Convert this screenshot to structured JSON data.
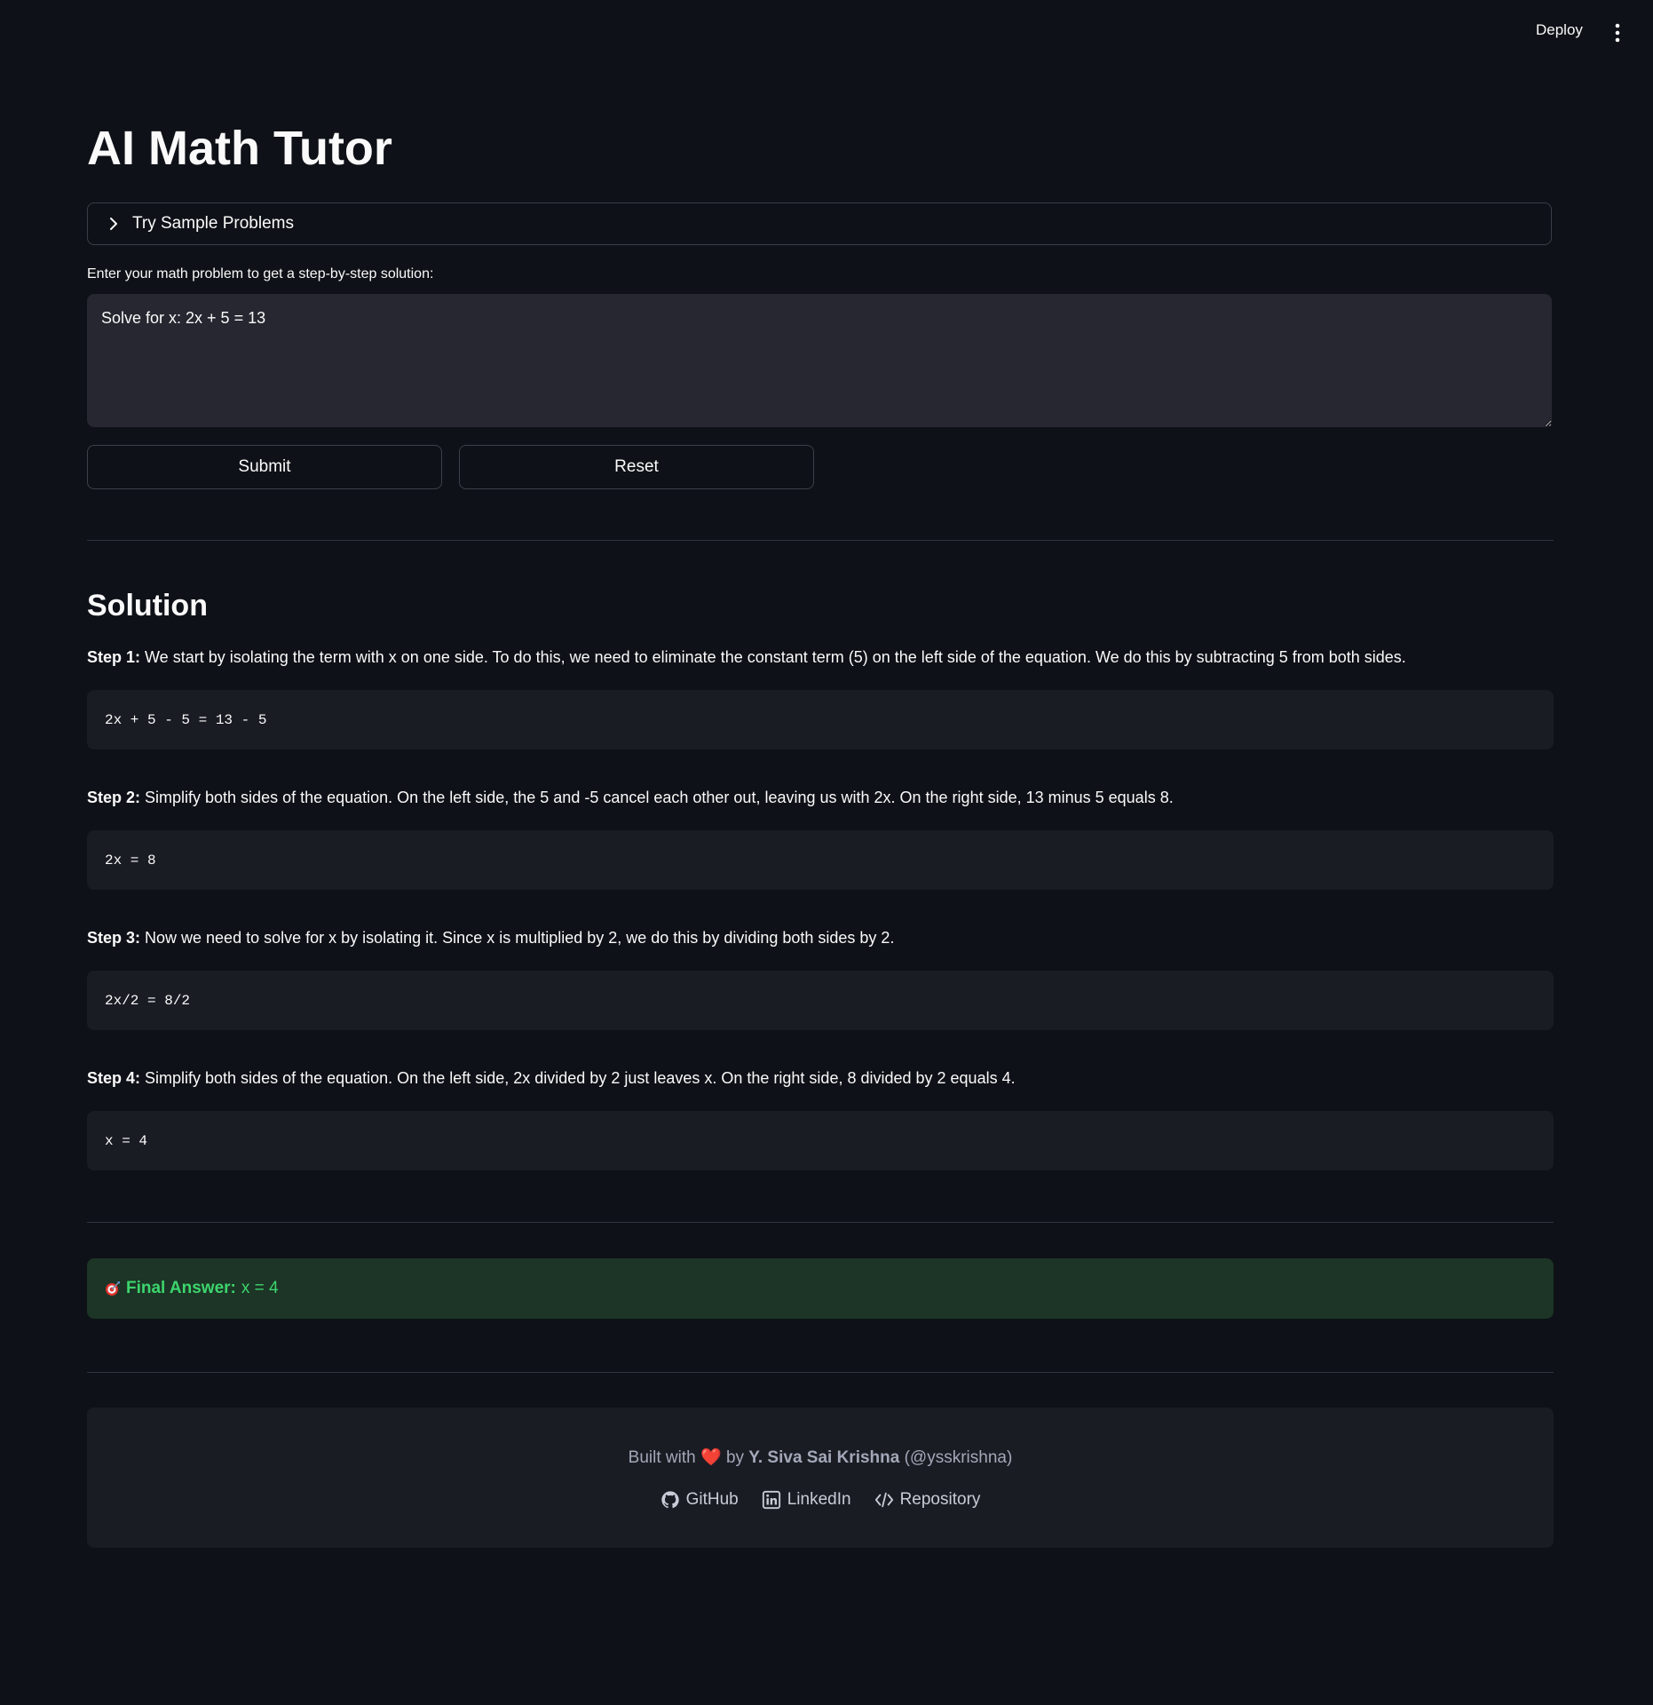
{
  "topbar": {
    "deploy_label": "Deploy",
    "menu_icon": "more-vertical-icon"
  },
  "app": {
    "title": "AI Math Tutor"
  },
  "samples": {
    "label": "Try Sample Problems",
    "icon": "chevron-right-icon"
  },
  "input": {
    "label": "Enter your math problem to get a step-by-step solution:",
    "value": "Solve for x: 2x + 5 = 13"
  },
  "buttons": {
    "submit": "Submit",
    "reset": "Reset"
  },
  "solution": {
    "heading": "Solution",
    "steps": [
      {
        "label": "Step 1:",
        "text": " We start by isolating the term with x on one side. To do this, we need to eliminate the constant term (5) on the left side of the equation. We do this by subtracting 5 from both sides.",
        "code": "2x + 5 - 5 = 13 - 5"
      },
      {
        "label": "Step 2:",
        "text": " Simplify both sides of the equation. On the left side, the 5 and -5 cancel each other out, leaving us with 2x. On the right side, 13 minus 5 equals 8.",
        "code": "2x = 8"
      },
      {
        "label": "Step 3:",
        "text": " Now we need to solve for x by isolating it. Since x is multiplied by 2, we do this by dividing both sides by 2.",
        "code": "2x/2 = 8/2"
      },
      {
        "label": "Step 4:",
        "text": " Simplify both sides of the equation. On the left side, 2x divided by 2 just leaves x. On the right side, 8 divided by 2 equals 4.",
        "code": "x = 4"
      }
    ]
  },
  "final": {
    "icon": "target-icon",
    "label": "Final Answer:",
    "value": "x = 4"
  },
  "footer": {
    "built_with": "Built with",
    "heart": "❤️",
    "by": "by",
    "author": "Y. Siva Sai Krishna",
    "handle": "(@ysskrishna)",
    "links": [
      {
        "label": "GitHub",
        "icon": "github-icon"
      },
      {
        "label": "LinkedIn",
        "icon": "linkedin-icon"
      },
      {
        "label": "Repository",
        "icon": "code-icon"
      }
    ]
  },
  "colors": {
    "background": "#0e1117",
    "input_bg": "#262730",
    "code_bg": "#1a1c24",
    "success_bg": "#1c3526",
    "success_text": "#3dd56d",
    "heart": "#e0332e"
  }
}
